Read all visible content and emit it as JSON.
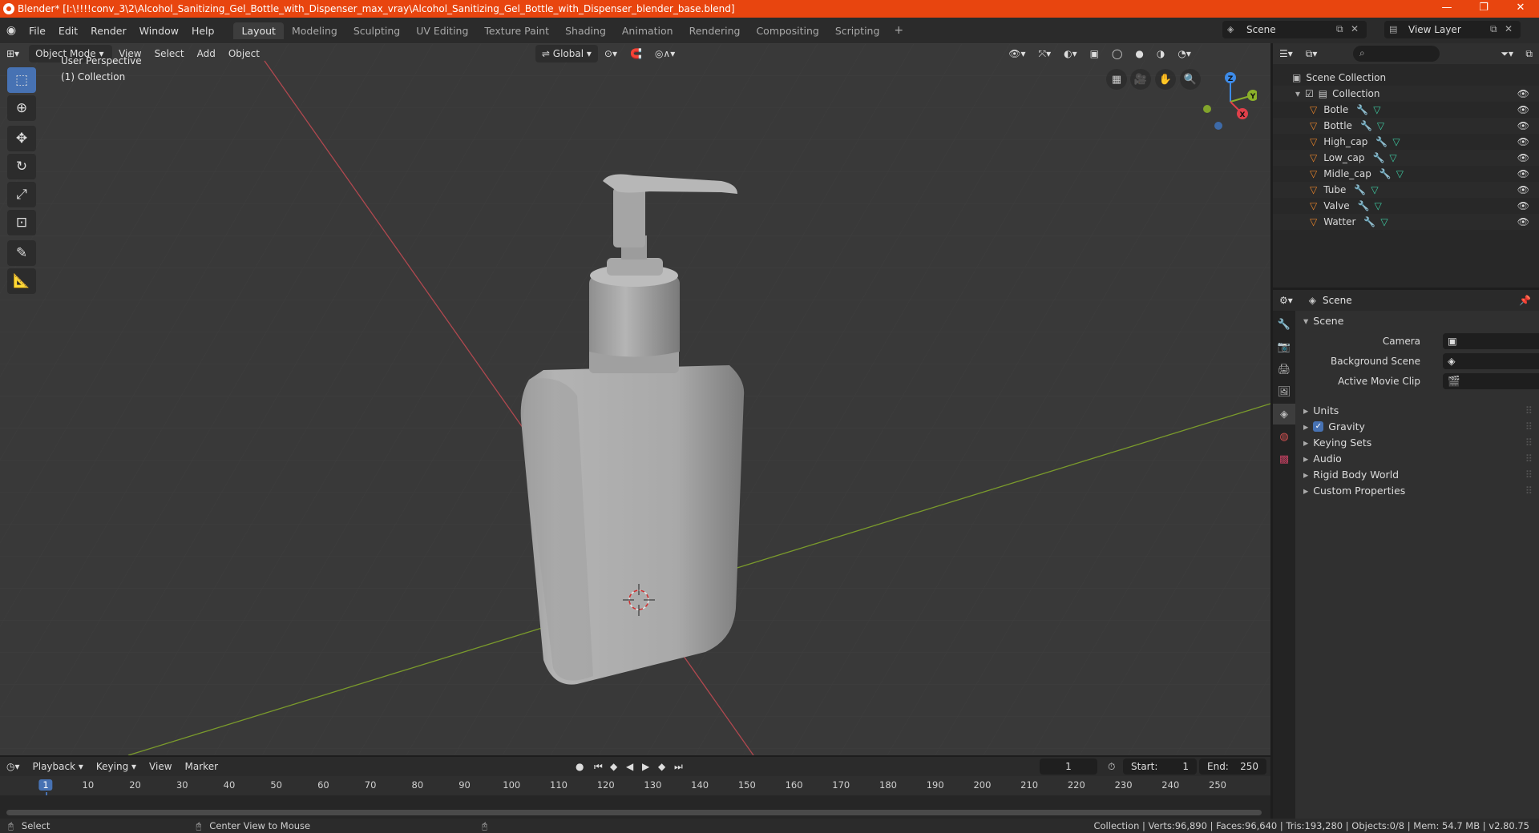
{
  "window": {
    "title": "Blender* [I:\\!!!!conv_3\\2\\Alcohol_Sanitizing_Gel_Bottle_with_Dispenser_max_vray\\Alcohol_Sanitizing_Gel_Bottle_with_Dispenser_blender_base.blend]",
    "controls": [
      "—",
      "❐",
      "✕"
    ]
  },
  "menu": {
    "items": [
      "File",
      "Edit",
      "Render",
      "Window",
      "Help"
    ],
    "workspaces": [
      "Layout",
      "Modeling",
      "Sculpting",
      "UV Editing",
      "Texture Paint",
      "Shading",
      "Animation",
      "Rendering",
      "Compositing",
      "Scripting"
    ],
    "active_workspace": "Layout",
    "scene_name": "Scene",
    "view_layer": "View Layer"
  },
  "viewport": {
    "mode": "Object Mode",
    "menus": [
      "View",
      "Select",
      "Add",
      "Object"
    ],
    "orientation": "Global",
    "perspective_label": "User Perspective",
    "collection_label": "(1) Collection",
    "gizmo_axes": {
      "x": "X",
      "y": "Y",
      "z": "Z"
    }
  },
  "outliner": {
    "root": "Scene Collection",
    "collection": "Collection",
    "objects": [
      "Botle",
      "Bottle",
      "High_cap",
      "Low_cap",
      "Midle_cap",
      "Tube",
      "Valve",
      "Watter"
    ]
  },
  "properties": {
    "context": "Scene",
    "panel_title": "Scene",
    "fields": [
      {
        "label": "Camera"
      },
      {
        "label": "Background Scene"
      },
      {
        "label": "Active Movie Clip"
      }
    ],
    "subpanels": [
      "Units",
      "Gravity",
      "Keying Sets",
      "Audio",
      "Rigid Body World",
      "Custom Properties"
    ],
    "gravity_checked": true
  },
  "timeline": {
    "menus": [
      "Playback",
      "Keying",
      "View",
      "Marker"
    ],
    "current_frame": "1",
    "start_label": "Start:",
    "start": "1",
    "end_label": "End:",
    "end": "250",
    "ticks": [
      "1",
      "10",
      "20",
      "30",
      "40",
      "50",
      "60",
      "70",
      "80",
      "90",
      "100",
      "110",
      "120",
      "130",
      "140",
      "150",
      "160",
      "170",
      "180",
      "190",
      "200",
      "210",
      "220",
      "230",
      "240",
      "250"
    ]
  },
  "status": {
    "left": "Select",
    "middle": "Center View to Mouse",
    "right": "Collection | Verts:96,890 | Faces:96,640 | Tris:193,280 | Objects:0/8 | Mem: 54.7 MB | v2.80.75"
  },
  "colors": {
    "titlebar": "#e8450f",
    "accent": "#4772b3",
    "x_axis": "#e0404a",
    "y_axis": "#8bb02a",
    "z_axis": "#3d8be8"
  }
}
